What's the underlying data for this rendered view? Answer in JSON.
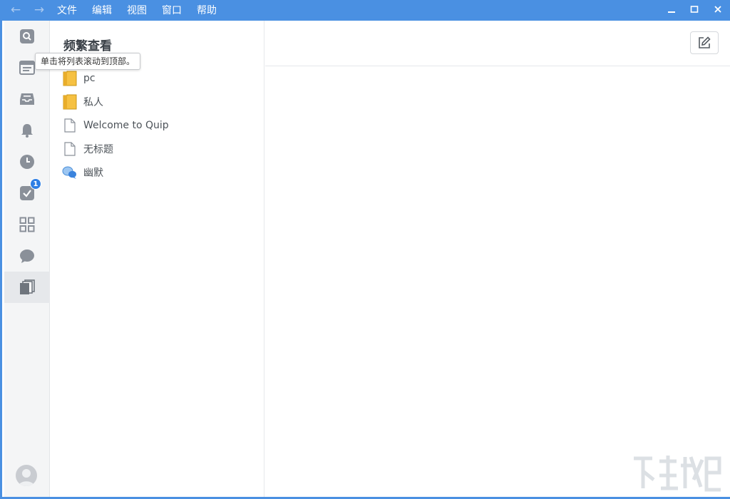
{
  "titlebar": {
    "back_icon": "arrow-left-icon",
    "forward_icon": "arrow-right-icon",
    "menus": [
      {
        "label": "文件"
      },
      {
        "label": "编辑"
      },
      {
        "label": "视图"
      },
      {
        "label": "窗口"
      },
      {
        "label": "帮助"
      }
    ],
    "minimize_glyph": "—",
    "maximize_glyph": "□",
    "close_glyph": "✕"
  },
  "sidebar": {
    "items": [
      {
        "icon": "search-icon"
      },
      {
        "icon": "browser-window-icon"
      },
      {
        "icon": "inbox-icon"
      },
      {
        "icon": "bell-icon"
      },
      {
        "icon": "clock-icon"
      },
      {
        "icon": "checkbox-icon",
        "badge": "1"
      },
      {
        "icon": "grid-icon"
      },
      {
        "icon": "chat-bubble-icon"
      },
      {
        "icon": "documents-icon",
        "active": true
      }
    ],
    "avatar_icon": "user-avatar-icon"
  },
  "list": {
    "title": "频繁查看",
    "tooltip": "单击将列表滚动到顶部。",
    "items": [
      {
        "label": "pc",
        "icon": "folder-icon"
      },
      {
        "label": "私人",
        "icon": "folder-icon"
      },
      {
        "label": "Welcome to Quip",
        "icon": "document-icon"
      },
      {
        "label": "无标题",
        "icon": "document-icon"
      },
      {
        "label": "幽默",
        "icon": "chat-icon"
      }
    ]
  },
  "doc": {
    "compose_icon": "compose-icon"
  },
  "colors": {
    "titlebar": "#4a90e2",
    "accent": "#2f7fe4",
    "folder": "#f6c142",
    "icon_gray": "#8a9099"
  }
}
